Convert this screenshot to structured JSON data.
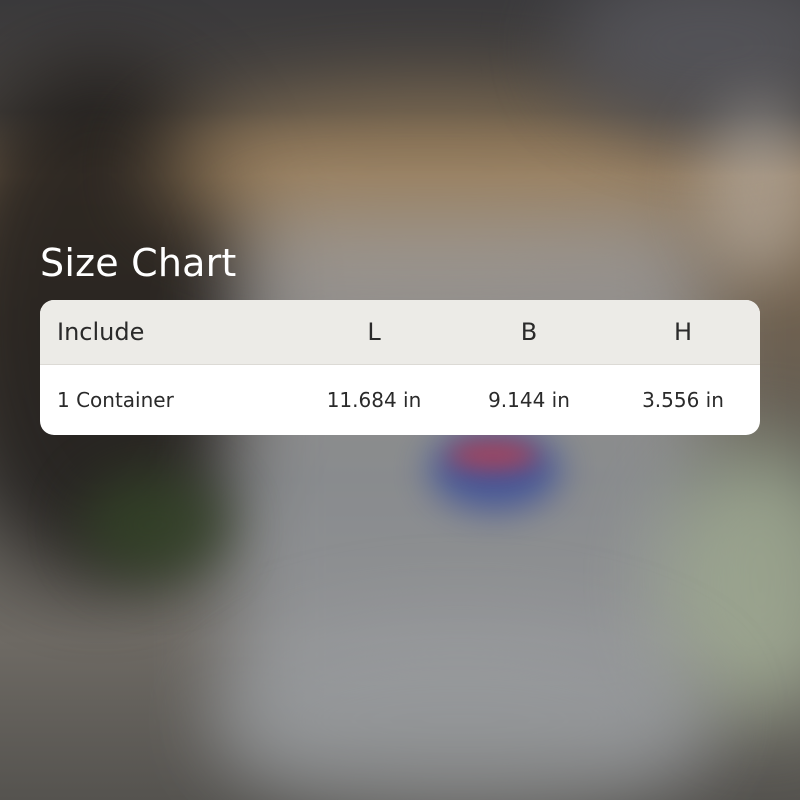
{
  "title": "Size Chart",
  "table": {
    "headers": {
      "include": "Include",
      "length": "L",
      "breadth": "B",
      "height": "H"
    },
    "rows": [
      {
        "include": "1 Container",
        "length": "11.684 in",
        "breadth": "9.144 in",
        "height": "3.556 in"
      }
    ]
  }
}
